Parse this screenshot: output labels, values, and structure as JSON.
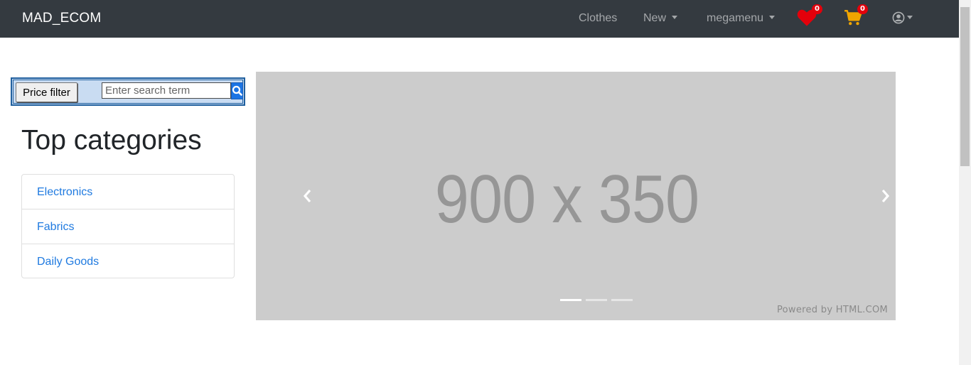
{
  "navbar": {
    "brand": "MAD_ECOM",
    "links": [
      {
        "label": "Clothes"
      },
      {
        "label": "New"
      },
      {
        "label": "megamenu"
      }
    ],
    "wishlist_count": "0",
    "cart_count": "0",
    "colors": {
      "background": "#343a40",
      "heart": "#e3000b",
      "cart": "#f0a500"
    }
  },
  "filter": {
    "price_button": "Price filter",
    "search_placeholder": "Enter search term"
  },
  "categories": {
    "title": "Top categories",
    "items": [
      {
        "label": "Electronics"
      },
      {
        "label": "Fabrics"
      },
      {
        "label": "Daily Goods"
      }
    ]
  },
  "carousel": {
    "placeholder_text": "900 x 350",
    "powered_by": "Powered by HTML.COM",
    "slide_count": 3,
    "active_slide": 1
  }
}
